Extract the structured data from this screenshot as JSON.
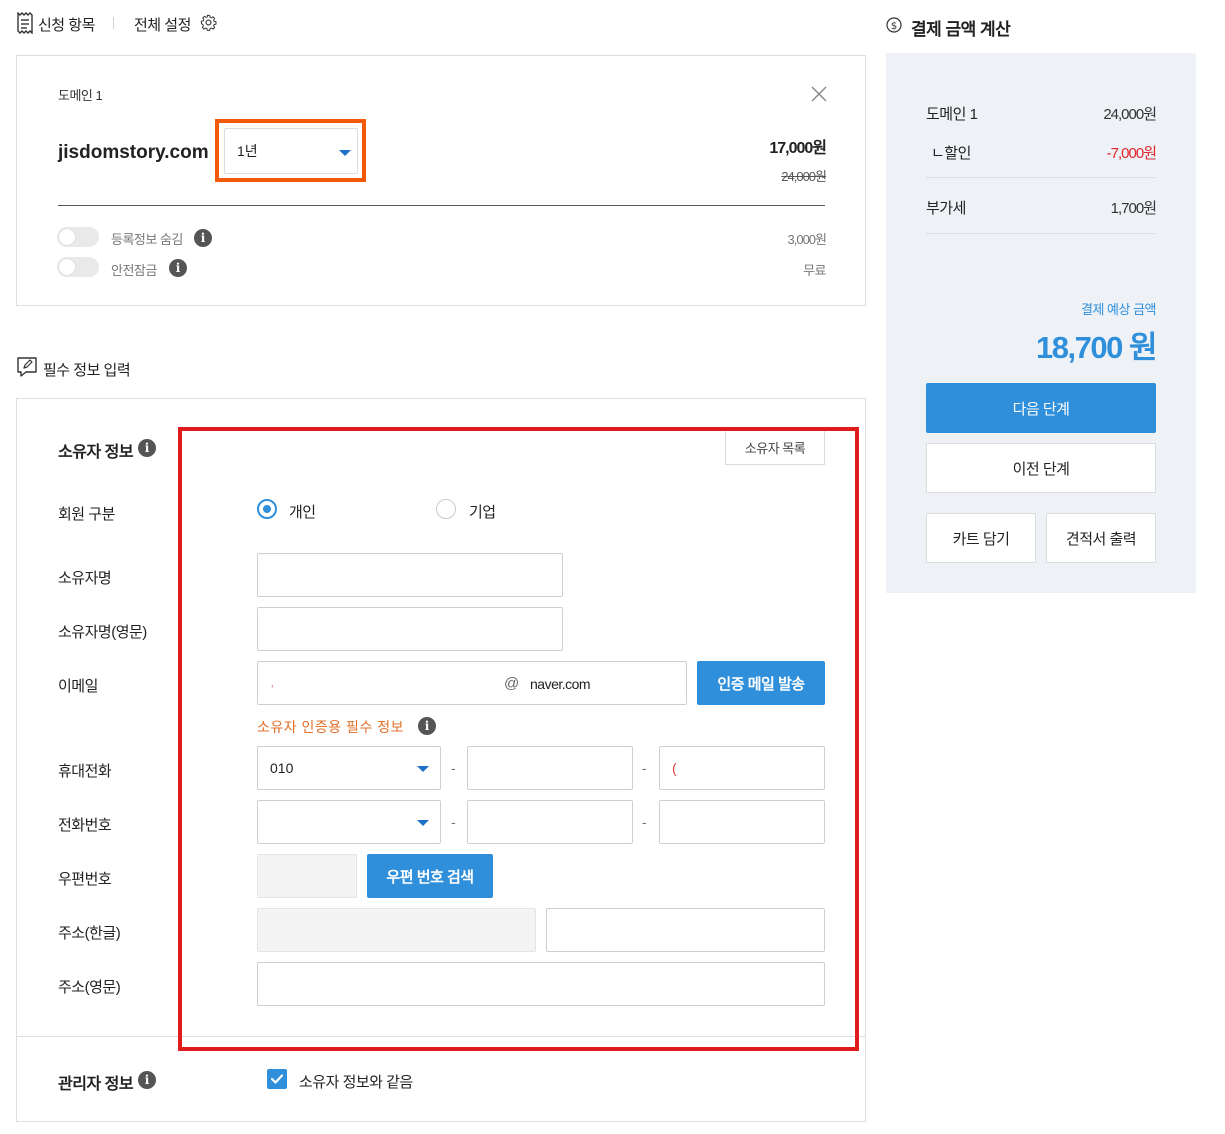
{
  "tabs": {
    "items_label": "신청 항목",
    "settings_label": "전체 설정"
  },
  "domain_card": {
    "title": "도메인 1",
    "domain_name": "jisdomstory.com",
    "period_selected": "1년",
    "price_current": "17,000원",
    "price_original": "24,000원",
    "options": [
      {
        "label": "등록정보 숨김",
        "price": "3,000원",
        "enabled": false
      },
      {
        "label": "안전잠금",
        "price": "무료",
        "enabled": false
      }
    ]
  },
  "required_section": {
    "title": "필수 정보 입력"
  },
  "owner_form": {
    "title": "소유자 정보",
    "owner_list_button": "소유자 목록",
    "member_type_label": "회원 구분",
    "member_types": [
      "개인",
      "기업"
    ],
    "member_type_selected": "개인",
    "name_label": "소유자명",
    "name_en_label": "소유자명(영문)",
    "email_label": "이메일",
    "email_local_value": "˒",
    "email_at": "@",
    "email_domain_value": "naver.com",
    "verify_email_button": "인증 메일 발송",
    "required_note": "소유자 인증용 필수 정보",
    "mobile_label": "휴대전화",
    "mobile_prefix": "010",
    "mobile_last_value": "(",
    "phone_label": "전화번호",
    "dash": "-",
    "zip_label": "우편번호",
    "zip_search_button": "우편 번호 검색",
    "address_ko_label": "주소(한글)",
    "address_en_label": "주소(영문)"
  },
  "admin_form": {
    "title": "관리자 정보",
    "same_as_owner_label": "소유자 정보와 같음",
    "same_as_owner_checked": true
  },
  "payment": {
    "title": "결제 금액 계산",
    "domain_label": "도메인 1",
    "domain_amount": "24,000원",
    "discount_label": "ㄴ할인",
    "discount_amount": "-7,000원",
    "vat_label": "부가세",
    "vat_amount": "1,700원",
    "total_label": "결제 예상 금액",
    "total_amount": "18,700 원",
    "next_button": "다음 단계",
    "prev_button": "이전 단계",
    "cart_button": "카트 담기",
    "quote_button": "견적서 출력"
  },
  "colors": {
    "accent_blue": "#2f8fdb",
    "highlight_orange": "#f25a0a",
    "highlight_red": "#e01b1b",
    "discount_red": "#e0242c",
    "note_orange": "#e0702a"
  }
}
